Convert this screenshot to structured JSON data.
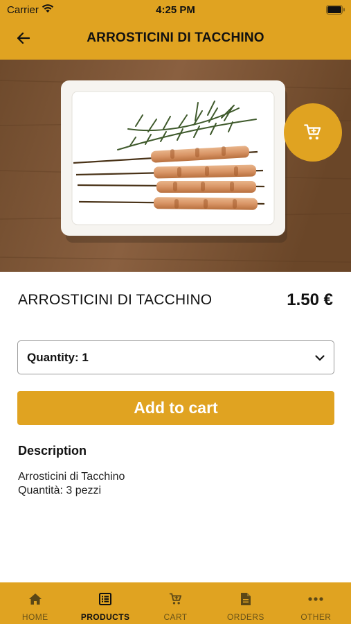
{
  "status_bar": {
    "carrier": "Carrier",
    "time": "4:25 PM"
  },
  "header": {
    "title": "ARROSTICINI DI TACCHINO",
    "back_icon": "arrow-left-icon"
  },
  "hero": {
    "cart_icon": "cart-icon",
    "image_subject": "turkey skewers with rosemary on white tray",
    "pages": 1,
    "current_page": 1
  },
  "product": {
    "name": "ARROSTICINI DI TACCHINO",
    "price": "1.50 €",
    "quantity_label": "Quantity: 1",
    "add_to_cart": "Add to cart",
    "description_title": "Description",
    "description": "Arrosticini di Tacchino\nQuantità: 3 pezzi"
  },
  "tabs": [
    {
      "label": "HOME",
      "icon": "home-icon",
      "active": false
    },
    {
      "label": "PRODUCTS",
      "icon": "list-icon",
      "active": true
    },
    {
      "label": "CART",
      "icon": "cart-icon",
      "active": false
    },
    {
      "label": "ORDERS",
      "icon": "document-icon",
      "active": false
    },
    {
      "label": "OTHER",
      "icon": "more-icon",
      "active": false
    }
  ],
  "colors": {
    "accent": "#E0A321",
    "text": "#111111",
    "background": "#FFFFFF"
  }
}
